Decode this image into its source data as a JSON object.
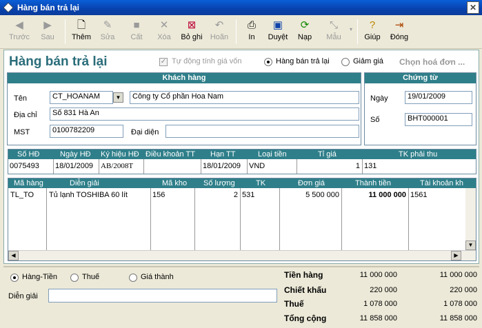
{
  "window": {
    "title": "Hàng bán trả lại",
    "close_symbol": "✕"
  },
  "toolbar": {
    "buttons": [
      {
        "label": "Trước",
        "icon": "◀"
      },
      {
        "label": "Sau",
        "icon": "▶"
      },
      {
        "label": "Thêm",
        "icon": "🗋"
      },
      {
        "label": "Sửa",
        "icon": "✎"
      },
      {
        "label": "Cất",
        "icon": "■"
      },
      {
        "label": "Xóa",
        "icon": "✕"
      },
      {
        "label": "Bỏ ghi",
        "icon": "⊠"
      },
      {
        "label": "Hoãn",
        "icon": "↶"
      },
      {
        "label": "In",
        "icon": "⎙"
      },
      {
        "label": "Duyệt",
        "icon": "▣"
      },
      {
        "label": "Nạp",
        "icon": "⟳"
      },
      {
        "label": "Mẫu",
        "icon": "⤡"
      },
      {
        "label": "Giúp",
        "icon": "?"
      },
      {
        "label": "Đóng",
        "icon": "⇥"
      }
    ]
  },
  "header": {
    "page_title": "Hàng bán trả lại",
    "auto_cost_label": "Tự động tính giá vốn",
    "auto_cost_checked": true,
    "radio_return": "Hàng bán trả lại",
    "radio_discount": "Giảm giá",
    "choose_invoice": "Chọn hoá đơn ..."
  },
  "customer": {
    "heading": "Khách hàng",
    "name_label": "Tên",
    "code": "CT_HOANAM",
    "name": "Công ty Cổ phần Hoa Nam",
    "address_label": "Địa chỉ",
    "address": "Số 831 Hà An",
    "tax_label": "MST",
    "tax_code": "0100782209",
    "rep_label": "Đại diện",
    "rep": ""
  },
  "voucher": {
    "heading": "Chứng từ",
    "date_label": "Ngày",
    "date": "19/01/2009",
    "no_label": "Số",
    "no": "BHT000001"
  },
  "invoice": {
    "headers": [
      "Số HĐ",
      "Ngày HĐ",
      "Ký hiệu HĐ",
      "Điều khoản TT",
      "Hạn TT",
      "Loại tiền",
      "Tỉ giá",
      "TK phải thu"
    ],
    "row": [
      "0075493",
      "18/01/2009",
      "AB/2008T",
      "",
      "18/01/2009",
      "VND",
      "1",
      "131"
    ]
  },
  "items": {
    "headers": [
      "Mã hàng",
      "Diễn giải",
      "Mã kho",
      "Số lượng",
      "TK",
      "Đơn giá",
      "Thành tiền",
      "Tài khoản kh"
    ],
    "rows": [
      [
        "TL_TO",
        "Tủ lạnh TOSHIBA 60 lít",
        "156",
        "2",
        "531",
        "5 500 000",
        "11 000 000",
        "1561"
      ]
    ]
  },
  "footer": {
    "tab_goods": "Hàng-Tiền",
    "tab_tax": "Thuế",
    "tab_cost": "Giá thành",
    "desc_label": "Diễn giải",
    "desc": "",
    "totals": [
      {
        "label": "Tiền hàng",
        "a": "11 000 000",
        "b": "11 000 000"
      },
      {
        "label": "Chiết khấu",
        "a": "220 000",
        "b": "220 000"
      },
      {
        "label": "Thuế",
        "a": "1 078 000",
        "b": "1 078 000"
      },
      {
        "label": "Tổng cộng",
        "a": "11 858 000",
        "b": "11 858 000"
      }
    ]
  }
}
